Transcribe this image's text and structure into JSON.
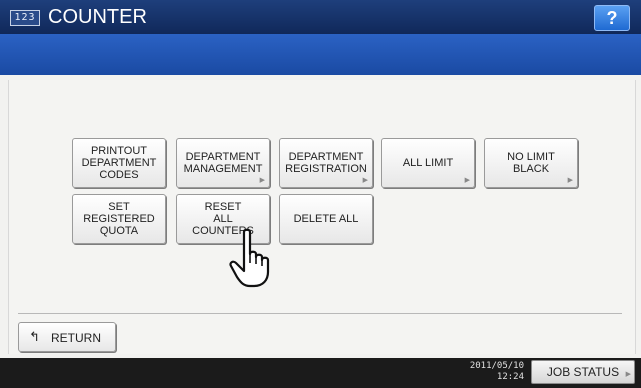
{
  "header": {
    "icon_text": "123",
    "title": "COUNTER",
    "help_label": "?"
  },
  "buttons": [
    {
      "label": "PRINTOUT\nDEPARTMENT\nCODES",
      "has_arrow": false
    },
    {
      "label": "DEPARTMENT\nMANAGEMENT",
      "has_arrow": true
    },
    {
      "label": "DEPARTMENT\nREGISTRATION",
      "has_arrow": true
    },
    {
      "label": "ALL LIMIT",
      "has_arrow": true
    },
    {
      "label": "NO LIMIT\nBLACK",
      "has_arrow": true
    },
    {
      "label": "SET\nREGISTERED\nQUOTA",
      "has_arrow": false
    },
    {
      "label": "RESET\nALL\nCOUNTERS",
      "has_arrow": false
    },
    {
      "label": "DELETE ALL",
      "has_arrow": false
    }
  ],
  "footer": {
    "return_label": "RETURN",
    "date": "2011/05/10",
    "time": "12:24",
    "job_status_label": "JOB STATUS"
  },
  "icons": {
    "return": "return-arrow-icon",
    "cursor": "hand-pointer-icon",
    "help": "help-icon"
  },
  "colors": {
    "header": "#10285a",
    "info_bar": "#1a4aa3",
    "help_button": "#1f6ad2",
    "status_bar": "#1b1b1b"
  }
}
